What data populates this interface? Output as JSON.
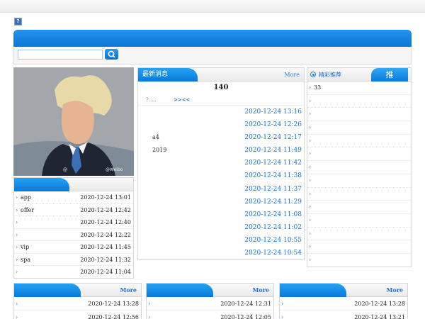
{
  "header": {
    "help_label": "?"
  },
  "search": {
    "value": "",
    "placeholder": ""
  },
  "photo": {
    "watermark_left": "@",
    "watermark_right": "@Weibo"
  },
  "news": {
    "tab": "最新消息",
    "more": "More",
    "count": "140",
    "pager_left": "?.....",
    "pager_nav": ">><<",
    "rows": [
      {
        "label": "",
        "date": "2020-12-24 13:16"
      },
      {
        "label": "",
        "date": "2020-12-24 12:26"
      },
      {
        "label": "a4",
        "date": "2020-12-24 12:17"
      },
      {
        "label": "2019",
        "date": "2020-12-24 11:49"
      },
      {
        "label": "",
        "date": "2020-12-24 11:42"
      },
      {
        "label": "",
        "date": "2020-12-24 11:38"
      },
      {
        "label": "",
        "date": "2020-12-24 11:37"
      },
      {
        "label": "",
        "date": "2020-12-24 11:29"
      },
      {
        "label": "",
        "date": "2020-12-24 11:08"
      },
      {
        "label": "",
        "date": "2020-12-24 11:02"
      },
      {
        "label": "",
        "date": "2020-12-24 10:55"
      },
      {
        "label": "",
        "date": "2020-12-24 10:54"
      }
    ]
  },
  "left_list": {
    "rows": [
      {
        "label": "app",
        "date": "2020-12-24 13:01"
      },
      {
        "label": "offer",
        "date": "2020-12-24 12:42"
      },
      {
        "label": "",
        "date": "2020-12-24 12:40"
      },
      {
        "label": "",
        "date": "2020-12-24 12:22"
      },
      {
        "label": "vip",
        "date": "2020-12-24 11:45"
      },
      {
        "label": "spa",
        "date": "2020-12-24 11:32"
      },
      {
        "label": "",
        "date": "2020-12-24 11:04"
      }
    ]
  },
  "featured": {
    "title": "精彩推荐",
    "badge": "推",
    "rows": [
      "33",
      "",
      "",
      "",
      "",
      "",
      "",
      "",
      "",
      "",
      "",
      "",
      "",
      ""
    ]
  },
  "bottom_panels": [
    {
      "more": "More",
      "rows": [
        {
          "label": "",
          "date": "2020-12-24 13:28"
        },
        {
          "label": "",
          "date": "2020-12-24 12:56"
        }
      ]
    },
    {
      "more": "More",
      "rows": [
        {
          "label": "",
          "date": "2020-12-24 12:31"
        },
        {
          "label": "",
          "date": "2020-12-24 12:05"
        }
      ]
    },
    {
      "more": "More",
      "rows": [
        {
          "label": "",
          "date": "2020-12-24 13:28"
        },
        {
          "label": "",
          "date": "2020-12-24 13:21"
        }
      ]
    }
  ],
  "colors": {
    "accent": "#0b78d8",
    "link": "#1b6fd0"
  }
}
